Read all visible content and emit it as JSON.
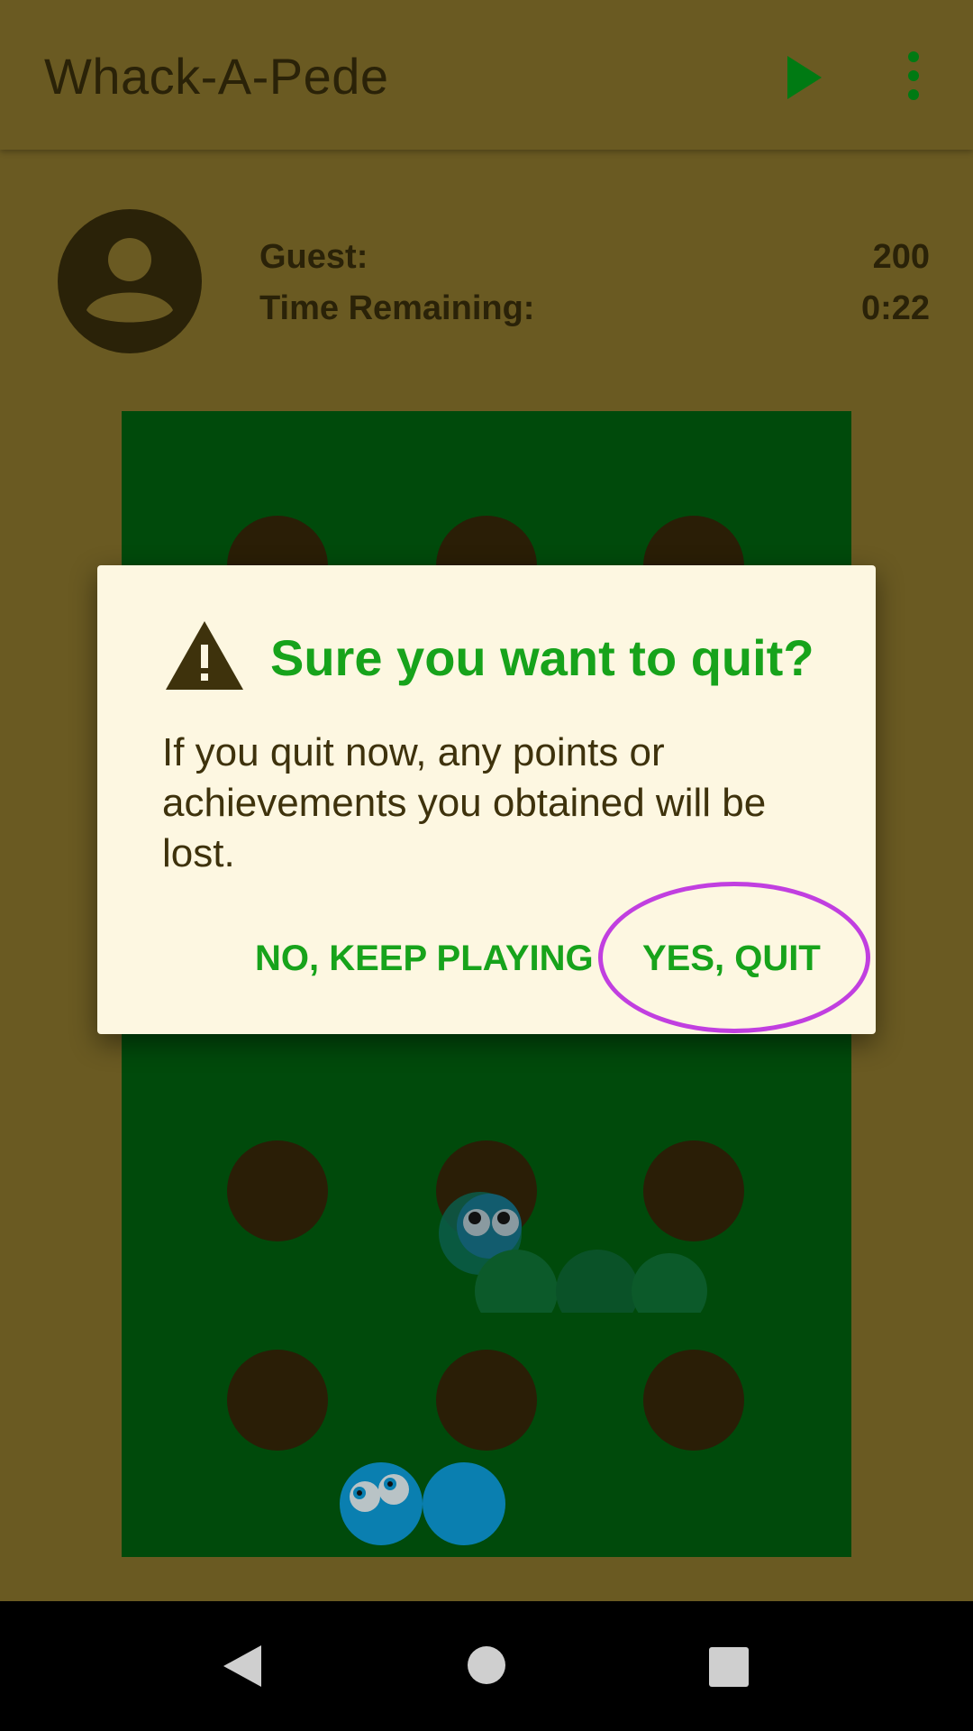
{
  "app_bar": {
    "title": "Whack-A-Pede",
    "play_icon": "play-icon",
    "more_icon": "more-vert-icon",
    "icon_color": "#007a13"
  },
  "player": {
    "avatar_icon": "account-circle-icon",
    "name_label": "Guest:",
    "score": "200",
    "time_label": "Time Remaining:",
    "time_value": "0:22"
  },
  "dialog": {
    "icon": "warning-icon",
    "title": "Sure you want to quit?",
    "message": "If you quit now, any points or achievements you obtained will be lost.",
    "negative_button": "NO, KEEP PLAYING",
    "positive_button": "YES, QUIT"
  },
  "colors": {
    "accent": "#17a31b",
    "board": "#004a0b",
    "highlight": "#c13fe0"
  },
  "nav_bar": {
    "back_icon": "back-icon",
    "home_icon": "home-icon",
    "recents_icon": "recents-icon"
  }
}
